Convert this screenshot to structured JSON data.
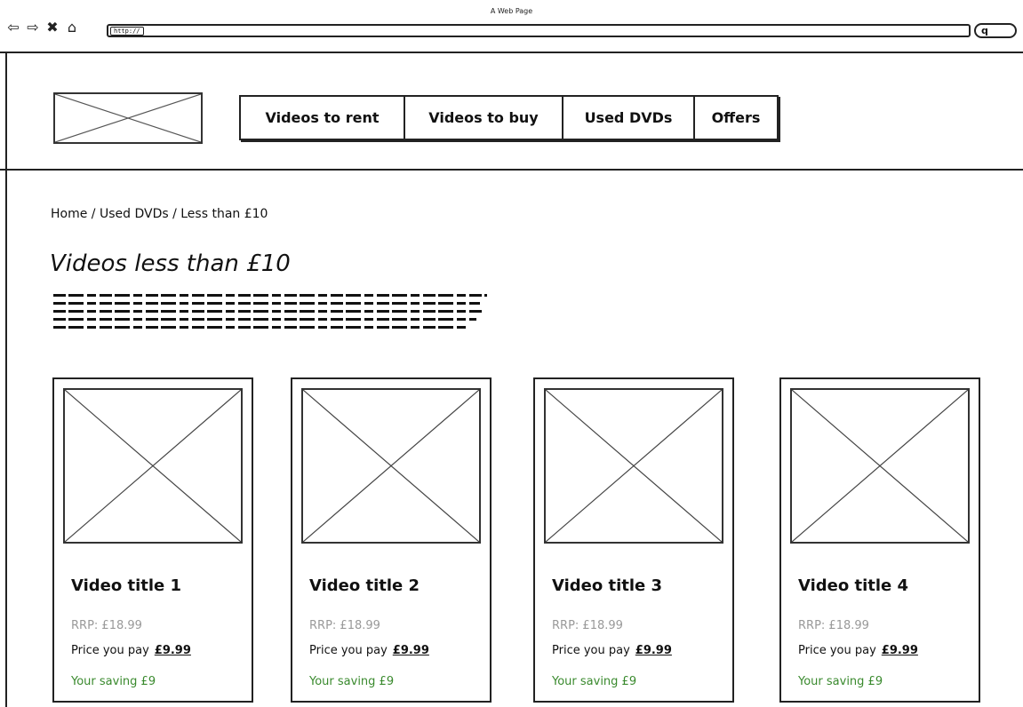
{
  "window": {
    "title": "A Web Page",
    "url": "http://"
  },
  "browser_icons": [
    "back-arrow-icon",
    "forward-arrow-icon",
    "close-icon",
    "home-icon",
    "search-icon"
  ],
  "nav": {
    "items": [
      {
        "label": "Videos to rent"
      },
      {
        "label": "Videos to buy"
      },
      {
        "label": "Used DVDs"
      },
      {
        "label": "Offers"
      }
    ]
  },
  "breadcrumb": "Home / Used DVDs / Less than £10",
  "page_title": "Videos less than £10",
  "products": [
    {
      "title": "Video title 1",
      "rrp": "RRP: £18.99",
      "pay_label": "Price you pay",
      "price": "£9.99",
      "saving": "Your saving £9"
    },
    {
      "title": "Video title 2",
      "rrp": "RRP: £18.99",
      "pay_label": "Price you pay",
      "price": "£9.99",
      "saving": "Your saving £9"
    },
    {
      "title": "Video title 3",
      "rrp": "RRP: £18.99",
      "pay_label": "Price you pay",
      "price": "£9.99",
      "saving": "Your saving £9"
    },
    {
      "title": "Video title 4",
      "rrp": "RRP: £18.99",
      "pay_label": "Price you pay",
      "price": "£9.99",
      "saving": "Your saving £9"
    }
  ],
  "colors": {
    "saving_text": "#3a8a2e",
    "rrp_text": "#999999",
    "stroke": "#222222"
  }
}
